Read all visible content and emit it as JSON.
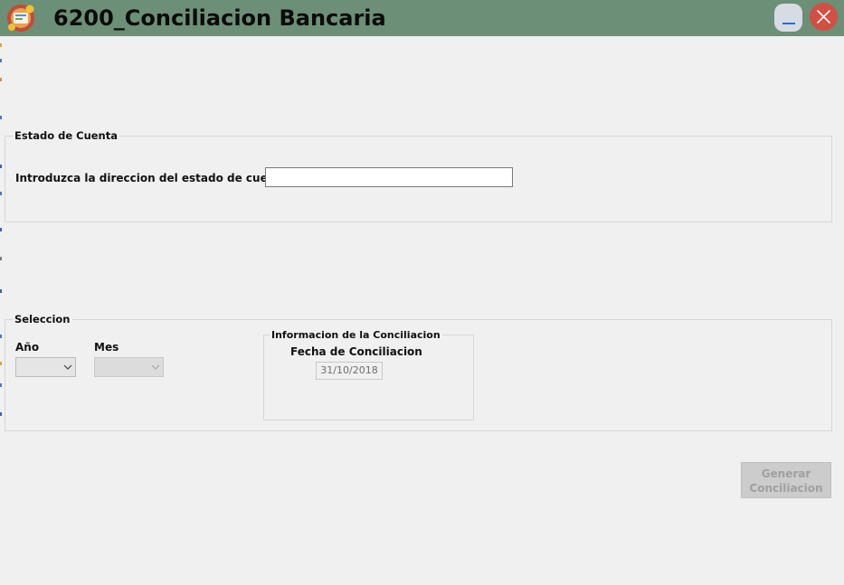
{
  "window": {
    "title": "6200_Conciliacion Bancaria",
    "app_icon": "accounting-app-icon",
    "minimize_icon": "minimize-icon",
    "close_icon": "close-icon",
    "titlebar_color": "#6b8f77"
  },
  "estado_cuenta": {
    "group_title": "Estado de Cuenta",
    "path_label": "Introduzca la direccion del estado de cuenta",
    "path_value": ""
  },
  "seleccion": {
    "group_title": "Seleccion",
    "year_label": "Año",
    "year_value": "",
    "month_label": "Mes",
    "month_value": "",
    "info_group_title": "Informacion de la Conciliacion",
    "fecha_label": "Fecha de Conciliacion",
    "fecha_value": "31/10/2018"
  },
  "actions": {
    "generate_label_line1": "Generar",
    "generate_label_line2": "Conciliacion"
  }
}
